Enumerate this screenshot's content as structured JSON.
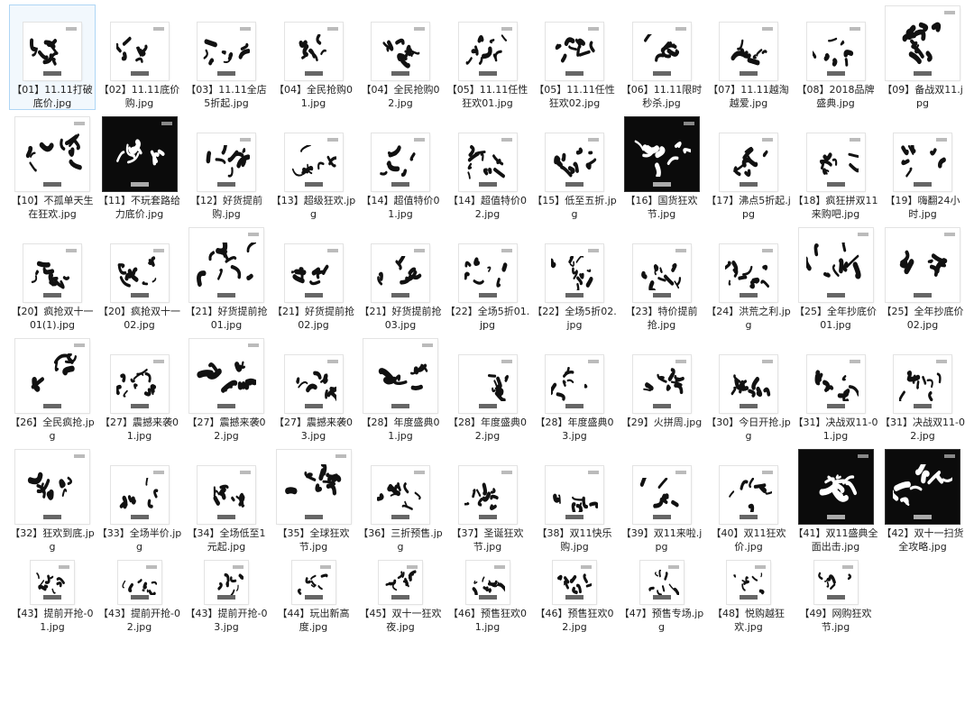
{
  "files": [
    {
      "label": "【01】11.11打破底价.jpg",
      "selected": true
    },
    {
      "label": "【02】11.11底价购.jpg"
    },
    {
      "label": "【03】11.11全店5折起.jpg"
    },
    {
      "label": "【04】全民抢购01.jpg"
    },
    {
      "label": "【04】全民抢购02.jpg"
    },
    {
      "label": "【05】11.11任性狂欢01.jpg"
    },
    {
      "label": "【05】11.11任性狂欢02.jpg"
    },
    {
      "label": "【06】11.11限时秒杀.jpg"
    },
    {
      "label": "【07】11.11越淘越爱.jpg"
    },
    {
      "label": "【08】2018品牌盛典.jpg"
    },
    {
      "label": "【09】备战双11.jpg"
    },
    {
      "label": "【10】不孤单天生在狂欢.jpg"
    },
    {
      "label": "【11】不玩套路给力底价.jpg",
      "dark": true
    },
    {
      "label": "【12】好货提前购.jpg"
    },
    {
      "label": "【13】超级狂欢.jpg"
    },
    {
      "label": "【14】超值特价01.jpg"
    },
    {
      "label": "【14】超值特价02.jpg"
    },
    {
      "label": "【15】低至五折.jpg"
    },
    {
      "label": "【16】国货狂欢节.jpg",
      "dark": true
    },
    {
      "label": "【17】沸点5折起.jpg"
    },
    {
      "label": "【18】疯狂拼双11来购吧.jpg"
    },
    {
      "label": "【19】嗨翻24小时.jpg"
    },
    {
      "label": "【20】疯抢双十一01(1).jpg"
    },
    {
      "label": "【20】疯抢双十一02.jpg"
    },
    {
      "label": "【21】好货提前抢01.jpg"
    },
    {
      "label": "【21】好货提前抢02.jpg"
    },
    {
      "label": "【21】好货提前抢03.jpg"
    },
    {
      "label": "【22】全场5折01.jpg"
    },
    {
      "label": "【22】全场5折02.jpg"
    },
    {
      "label": "【23】特价提前抢.jpg"
    },
    {
      "label": "【24】洪荒之利.jpg"
    },
    {
      "label": "【25】全年抄底价01.jpg"
    },
    {
      "label": "【25】全年抄底价02.jpg"
    },
    {
      "label": "【26】全民疯抢.jpg"
    },
    {
      "label": "【27】震撼来袭01.jpg"
    },
    {
      "label": "【27】震撼来袭02.jpg"
    },
    {
      "label": "【27】震撼来袭03.jpg"
    },
    {
      "label": "【28】年度盛典01.jpg"
    },
    {
      "label": "【28】年度盛典02.jpg"
    },
    {
      "label": "【28】年度盛典03.jpg"
    },
    {
      "label": "【29】火拼周.jpg"
    },
    {
      "label": "【30】今日开抢.jpg"
    },
    {
      "label": "【31】决战双11-01.jpg"
    },
    {
      "label": "【31】决战双11-02.jpg"
    },
    {
      "label": "【32】狂欢到底.jpg"
    },
    {
      "label": "【33】全场半价.jpg"
    },
    {
      "label": "【34】全场低至1元起.jpg"
    },
    {
      "label": "【35】全球狂欢节.jpg"
    },
    {
      "label": "【36】三折预售.jpg"
    },
    {
      "label": "【37】圣诞狂欢节.jpg"
    },
    {
      "label": "【38】双11快乐购.jpg"
    },
    {
      "label": "【39】双11来啦.jpg"
    },
    {
      "label": "【40】双11狂欢价.jpg"
    },
    {
      "label": "【41】双11盛典全面出击.jpg",
      "dark": true
    },
    {
      "label": "【42】双十一扫货全攻略.jpg",
      "dark": true
    },
    {
      "label": "【43】提前开抢-01.jpg"
    },
    {
      "label": "【43】提前开抢-02.jpg"
    },
    {
      "label": "【43】提前开抢-03.jpg"
    },
    {
      "label": "【44】玩出新高度.jpg"
    },
    {
      "label": "【45】双十一狂欢夜.jpg"
    },
    {
      "label": "【46】预售狂欢01.jpg"
    },
    {
      "label": "【46】预售狂欢02.jpg"
    },
    {
      "label": "【47】预售专场.jpg"
    },
    {
      "label": "【48】悦购越狂欢.jpg"
    },
    {
      "label": "【49】网购狂欢节.jpg"
    }
  ]
}
